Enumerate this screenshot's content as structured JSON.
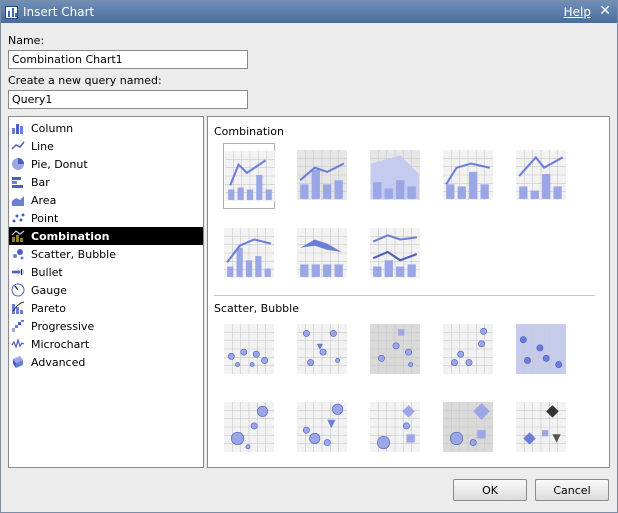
{
  "window": {
    "title": "Insert Chart",
    "help_link": "Help",
    "close_glyph": "✕"
  },
  "form": {
    "name_label": "Name:",
    "name_value": "Combination Chart1",
    "query_label": "Create a new query named:",
    "query_value": "Query1"
  },
  "chart_types": [
    {
      "label": "Column",
      "icon": "column-chart-icon"
    },
    {
      "label": "Line",
      "icon": "line-chart-icon"
    },
    {
      "label": "Pie, Donut",
      "icon": "pie-chart-icon"
    },
    {
      "label": "Bar",
      "icon": "bar-chart-icon"
    },
    {
      "label": "Area",
      "icon": "area-chart-icon"
    },
    {
      "label": "Point",
      "icon": "point-chart-icon"
    },
    {
      "label": "Combination",
      "icon": "combination-chart-icon",
      "selected": true
    },
    {
      "label": "Scatter, Bubble",
      "icon": "scatter-chart-icon"
    },
    {
      "label": "Bullet",
      "icon": "bullet-chart-icon"
    },
    {
      "label": "Gauge",
      "icon": "gauge-chart-icon"
    },
    {
      "label": "Pareto",
      "icon": "pareto-chart-icon"
    },
    {
      "label": "Progressive",
      "icon": "progressive-chart-icon"
    },
    {
      "label": "Microchart",
      "icon": "microchart-icon"
    },
    {
      "label": "Advanced",
      "icon": "advanced-chart-icon"
    }
  ],
  "gallery": {
    "combination_title": "Combination",
    "scatter_title": "Scatter, Bubble",
    "combination_count": 8,
    "scatter_count": 10
  },
  "buttons": {
    "ok": "OK",
    "cancel": "Cancel"
  },
  "colors": {
    "accent": "#6c7fd8",
    "selection": "#000000",
    "titlebar": "#4a6d9b"
  }
}
